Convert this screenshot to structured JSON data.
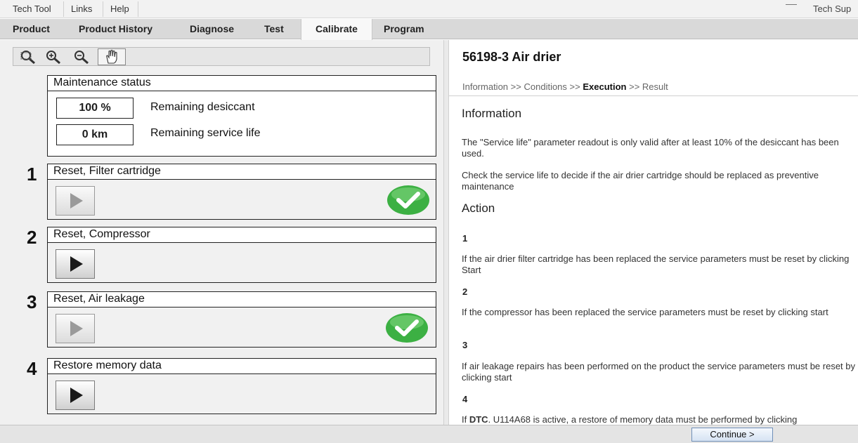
{
  "menu": {
    "items": [
      "Tech Tool",
      "Links",
      "Help"
    ],
    "right_label": "Tech Sup"
  },
  "tabs": [
    {
      "label": "Product"
    },
    {
      "label": "Product History"
    },
    {
      "label": "Diagnose"
    },
    {
      "label": "Test"
    },
    {
      "label": "Calibrate",
      "active": true
    },
    {
      "label": "Program"
    }
  ],
  "toolbar": {
    "icons": [
      "zoom-fit-icon",
      "zoom-in-icon",
      "zoom-out-icon",
      "pan-hand-icon"
    ]
  },
  "maintenance": {
    "title": "Maintenance status",
    "rows": [
      {
        "value": "100 %",
        "label": "Remaining desiccant"
      },
      {
        "value": "0 km",
        "label": "Remaining service life"
      }
    ]
  },
  "steps": [
    {
      "number": "1",
      "title": "Reset, Filter cartridge",
      "enabled": false,
      "completed": true
    },
    {
      "number": "2",
      "title": "Reset, Compressor",
      "enabled": true,
      "completed": false
    },
    {
      "number": "3",
      "title": "Reset, Air leakage",
      "enabled": false,
      "completed": true
    },
    {
      "number": "4",
      "title": "Restore memory data",
      "enabled": true,
      "completed": false
    }
  ],
  "right": {
    "title": "56198-3 Air drier",
    "breadcrumb": {
      "b1": "Information",
      "b2": "Conditions",
      "current": "Execution",
      "b4": "Result",
      "sep": ">>"
    },
    "info_heading": "Information",
    "info_p1": "The \"Service life\" parameter readout is only valid after at least 10% of the desiccant has been used.",
    "info_p2": "Check the service life to decide if the air drier cartridge should be replaced as preventive maintenance",
    "action_heading": "Action",
    "actions": [
      {
        "num": "1",
        "text": "If the air drier filter cartridge has been replaced the service parameters must be reset by clicking Start"
      },
      {
        "num": "2",
        "text": "If the compressor has been replaced the service parameters must be reset by clicking start"
      },
      {
        "num": "3",
        "text": "If air leakage repairs has been performed on the product the service parameters must be reset by clicking start"
      },
      {
        "num": "4",
        "text_prefix": "If ",
        "text_bold": "DTC",
        "text_rest": ". U114A68 is active, a restore of memory data must be performed by clicking"
      }
    ]
  },
  "footer": {
    "continue_label": "Continue >"
  },
  "colors": {
    "check_green": "#3cb043",
    "tab_active_bg": "#f8f8f8",
    "link_blue_border": "#6f8fb8"
  }
}
